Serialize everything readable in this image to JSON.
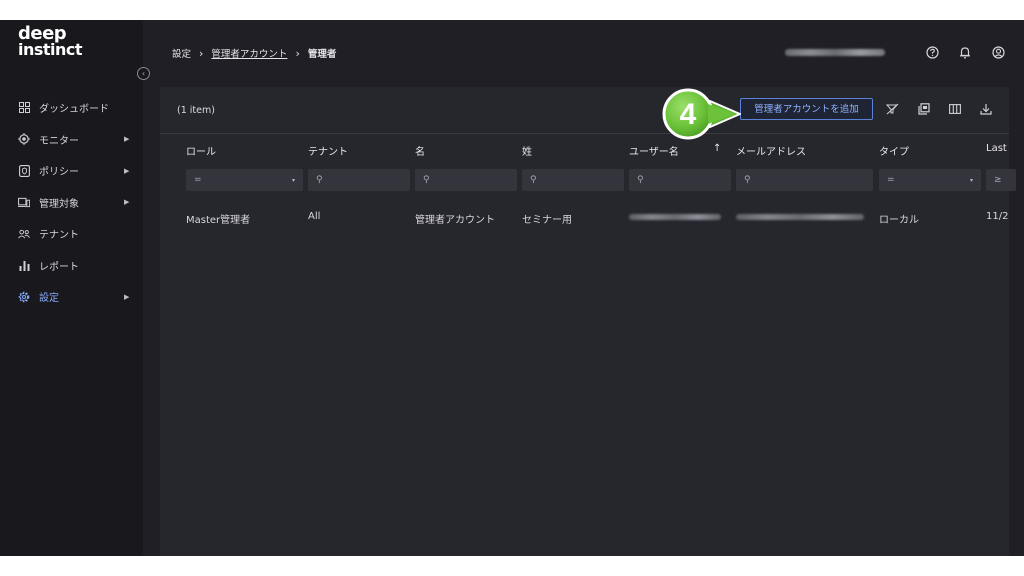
{
  "logo": {
    "line1": "deep",
    "line2": "instinct"
  },
  "sidebar": {
    "collapse_label": "‹",
    "items": [
      {
        "label": "ダッシュボード",
        "icon": "dashboard-icon",
        "has_submenu": false,
        "active": false
      },
      {
        "label": "モニター",
        "icon": "monitor-icon",
        "has_submenu": true,
        "active": false
      },
      {
        "label": "ポリシー",
        "icon": "policy-icon",
        "has_submenu": true,
        "active": false
      },
      {
        "label": "管理対象",
        "icon": "devices-icon",
        "has_submenu": true,
        "active": false
      },
      {
        "label": "テナント",
        "icon": "tenant-icon",
        "has_submenu": false,
        "active": false
      },
      {
        "label": "レポート",
        "icon": "report-icon",
        "has_submenu": false,
        "active": false
      },
      {
        "label": "設定",
        "icon": "settings-gear-icon",
        "has_submenu": true,
        "active": true
      }
    ],
    "chevron": "▶"
  },
  "breadcrumb": {
    "root": "設定",
    "parent": "管理者アカウント",
    "current": "管理者",
    "separator": "›"
  },
  "header_icons": [
    "help-icon",
    "bell-icon",
    "account-icon"
  ],
  "table": {
    "item_count": "(1 item)",
    "add_button_label": "管理者アカウントを追加",
    "toolbar_icons": [
      "clear-filter-icon",
      "copy-icon",
      "columns-icon",
      "download-icon"
    ],
    "callout_number": "4",
    "sort_indicator": "↑",
    "columns": [
      {
        "label": "ロール",
        "filter": "=",
        "filter_type": "select"
      },
      {
        "label": "テナント",
        "filter": "⚲",
        "filter_type": "search"
      },
      {
        "label": "名",
        "filter": "⚲",
        "filter_type": "search"
      },
      {
        "label": "姓",
        "filter": "⚲",
        "filter_type": "search"
      },
      {
        "label": "ユーザー名",
        "filter": "⚲",
        "filter_type": "search"
      },
      {
        "label": "メールアドレス",
        "filter": "⚲",
        "filter_type": "search"
      },
      {
        "label": "タイプ",
        "filter": "=",
        "filter_type": "select"
      },
      {
        "label": "Last",
        "filter": "≥",
        "filter_type": "select"
      }
    ],
    "rows": [
      {
        "role": "Master管理者",
        "tenant": "All",
        "first_name": "管理者アカウント",
        "last_name": "セミナー用",
        "type": "ローカル",
        "last": "11/2"
      }
    ],
    "dropdown_glyph": "▾"
  },
  "colors": {
    "accent": "#86a9f5",
    "button_border": "#5b82d9",
    "callout_green": "#6cc23a",
    "background": "#1f1f25",
    "panel": "#26262d"
  }
}
